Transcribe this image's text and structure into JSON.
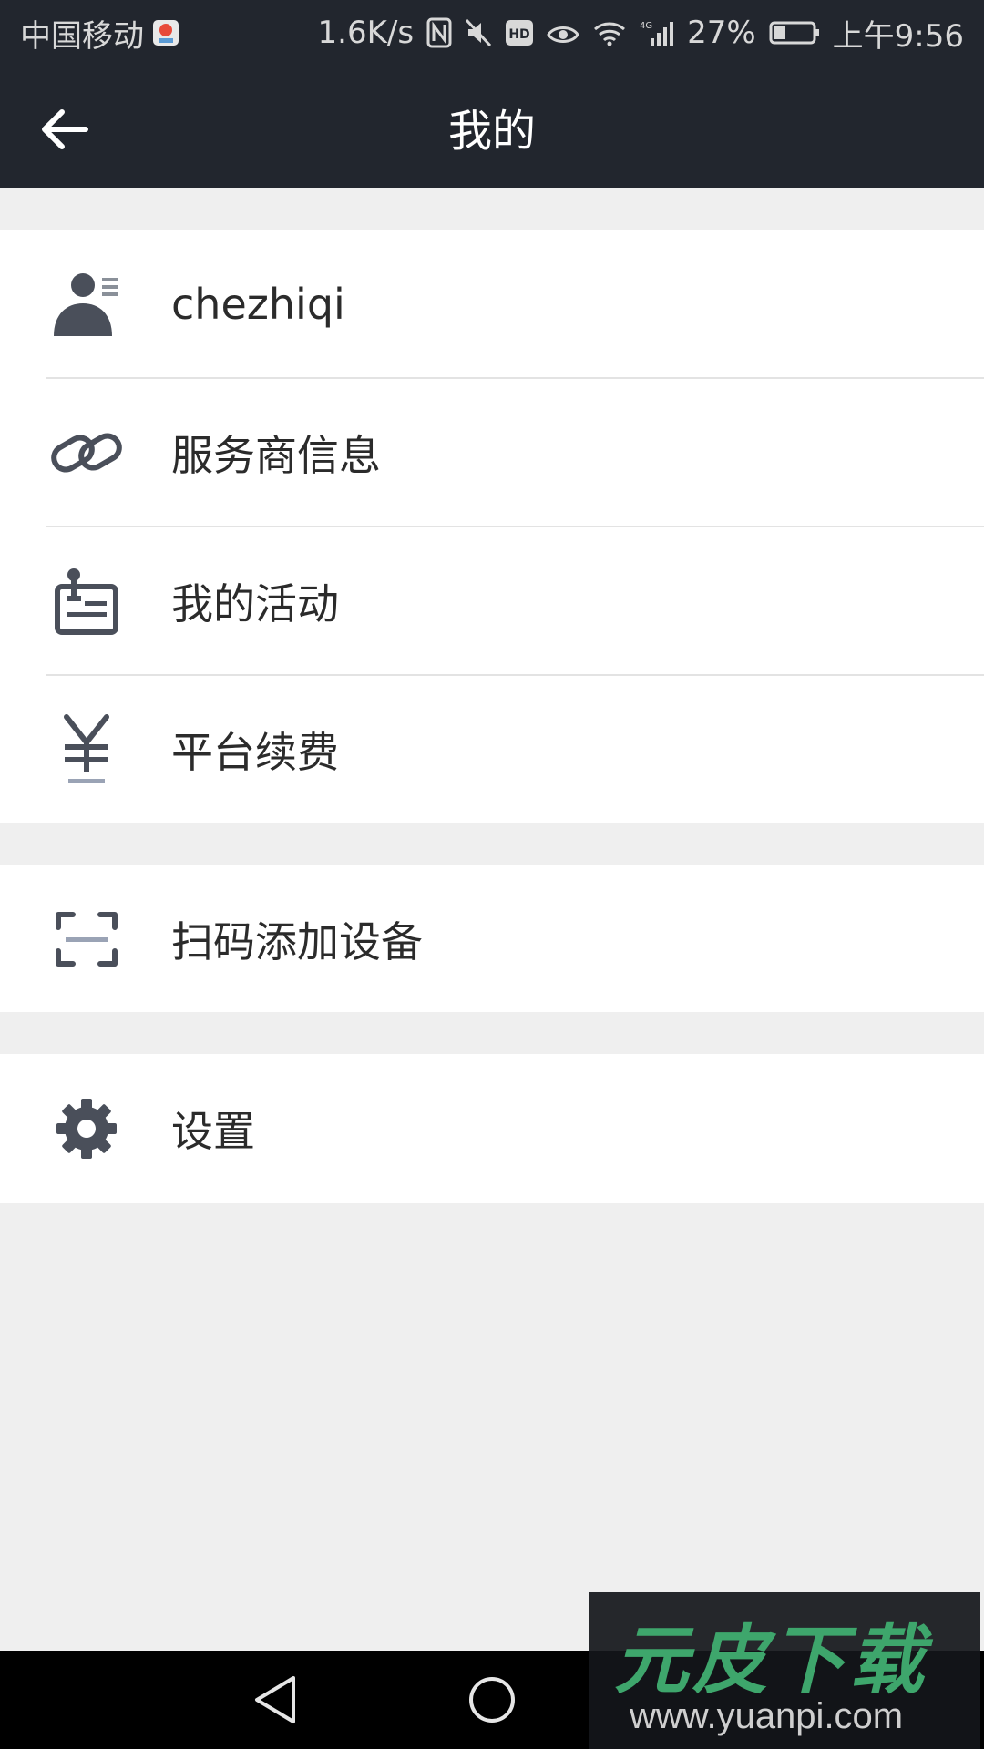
{
  "status_bar": {
    "carrier": "中国移动",
    "net_speed": "1.6K/s",
    "battery": "27%",
    "time": "上午9:56"
  },
  "nav": {
    "title": "我的"
  },
  "menu": {
    "profile": {
      "label": "chezhiqi"
    },
    "items": [
      {
        "label": "服务商信息",
        "icon": "link-icon"
      },
      {
        "label": "我的活动",
        "icon": "activity-clipboard-icon"
      },
      {
        "label": "平台续费",
        "icon": "yen-icon"
      }
    ],
    "scan": {
      "label": "扫码添加设备",
      "icon": "scan-icon"
    },
    "settings": {
      "label": "设置",
      "icon": "gear-icon"
    }
  },
  "watermark": {
    "title": "元皮下载",
    "url": "www.yuanpi.com"
  },
  "colors": {
    "header_bg": "#22262e",
    "page_bg": "#efefef",
    "icon": "#4a4f5a"
  }
}
